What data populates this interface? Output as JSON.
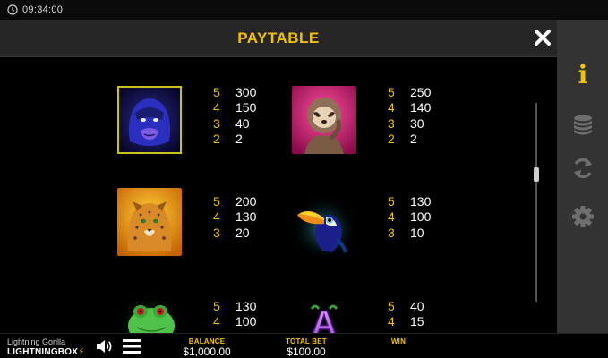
{
  "status_bar": {
    "time": "09:34:00",
    "icon": "clock-icon"
  },
  "header": {
    "title": "PAYTABLE",
    "close_icon": "close-icon"
  },
  "side_menu": {
    "items": [
      {
        "name": "info",
        "icon": "info-icon",
        "label": "i",
        "active": true
      },
      {
        "name": "bet",
        "icon": "coin-stack-icon",
        "active": false
      },
      {
        "name": "autoplay",
        "icon": "autoplay-icon",
        "active": false
      },
      {
        "name": "settings",
        "icon": "gear-icon",
        "active": false
      }
    ]
  },
  "paytable": {
    "rows": [
      [
        {
          "symbol": "gorilla",
          "payouts": [
            {
              "count": "5",
              "value": "300"
            },
            {
              "count": "4",
              "value": "150"
            },
            {
              "count": "3",
              "value": "40"
            },
            {
              "count": "2",
              "value": "2"
            }
          ]
        },
        {
          "symbol": "sloth",
          "payouts": [
            {
              "count": "5",
              "value": "250"
            },
            {
              "count": "4",
              "value": "140"
            },
            {
              "count": "3",
              "value": "30"
            },
            {
              "count": "2",
              "value": "2"
            }
          ]
        }
      ],
      [
        {
          "symbol": "jaguar",
          "payouts": [
            {
              "count": "5",
              "value": "200"
            },
            {
              "count": "4",
              "value": "130"
            },
            {
              "count": "3",
              "value": "20"
            }
          ]
        },
        {
          "symbol": "toucan",
          "payouts": [
            {
              "count": "5",
              "value": "130"
            },
            {
              "count": "4",
              "value": "100"
            },
            {
              "count": "3",
              "value": "10"
            }
          ]
        }
      ],
      [
        {
          "symbol": "frog",
          "payouts": [
            {
              "count": "5",
              "value": "130"
            },
            {
              "count": "4",
              "value": "100"
            }
          ]
        },
        {
          "symbol": "letter-a",
          "letter": "A",
          "payouts": [
            {
              "count": "5",
              "value": "40"
            },
            {
              "count": "4",
              "value": "15"
            }
          ]
        }
      ]
    ]
  },
  "bottom_bar": {
    "game_name": "Lightning Gorilla",
    "brand_lightning": "LIGHTNING",
    "brand_box": "BOX",
    "balance_label": "BALANCE",
    "balance_value": "$1,000.00",
    "total_bet_label": "TOTAL BET",
    "total_bet_value": "$100.00",
    "win_label": "WIN",
    "win_value": ""
  },
  "colors": {
    "accent": "#f2c200",
    "panel": "#262626",
    "side_menu": "#333333"
  }
}
